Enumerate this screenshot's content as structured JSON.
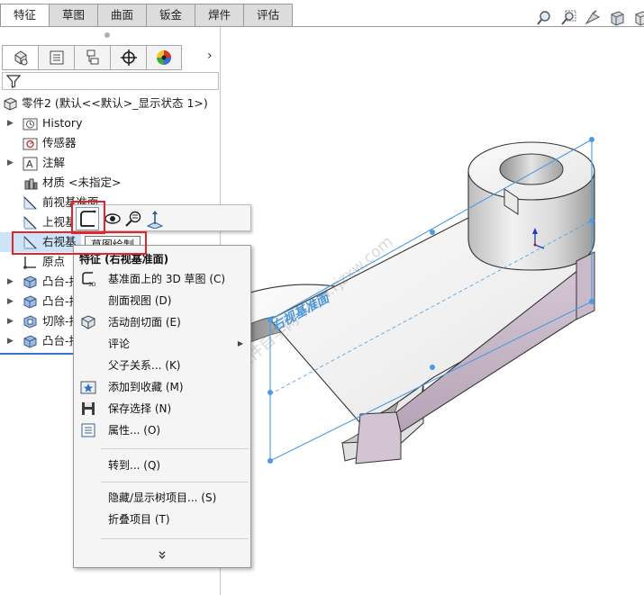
{
  "tabs": [
    "特征",
    "草图",
    "曲面",
    "钣金",
    "焊件",
    "评估"
  ],
  "active_tab": 0,
  "view_tools": [
    "zoom-to-fit-icon",
    "zoom-to-area-icon",
    "previous-view-icon",
    "section-view-icon",
    "view-orientation-icon"
  ],
  "manager_tabs": [
    "feature-manager-icon",
    "property-manager-icon",
    "configuration-manager-icon",
    "dimxpert-manager-icon",
    "display-manager-icon"
  ],
  "manager_more": "›",
  "tree": {
    "root": "零件2  (默认<<默认>_显示状态 1>)",
    "items": [
      {
        "label": "History",
        "icon": "history-folder-icon",
        "expand": true
      },
      {
        "label": "传感器",
        "icon": "sensor-icon",
        "expand": false
      },
      {
        "label": "注解",
        "icon": "annotations-icon",
        "expand": true
      },
      {
        "label": "材质 <未指定>",
        "icon": "material-icon",
        "expand": false
      },
      {
        "label": "前视基准面",
        "icon": "plane-icon",
        "expand": false
      },
      {
        "label": "上视基",
        "icon": "plane-icon",
        "expand": false
      },
      {
        "label": "右视基",
        "icon": "plane-icon",
        "expand": false
      },
      {
        "label": "原点",
        "icon": "origin-icon",
        "expand": false
      },
      {
        "label": "凸台-拉",
        "icon": "boss-extrude-icon",
        "expand": true
      },
      {
        "label": "凸台-拉",
        "icon": "boss-extrude-icon",
        "expand": true
      },
      {
        "label": "切除-拉",
        "icon": "cut-extrude-icon",
        "expand": true
      },
      {
        "label": "凸台-拉",
        "icon": "boss-extrude-icon",
        "expand": true
      }
    ]
  },
  "tooltip": "草图绘制",
  "context_menu": {
    "title": "特征 (右视基准面)",
    "items": [
      {
        "label": "基准面上的 3D 草图 (C)",
        "icon": "3d-sketch-on-plane-icon"
      },
      {
        "label": "剖面视图 (D)",
        "icon": ""
      },
      {
        "label": "活动剖切面 (E)",
        "icon": "live-section-plane-icon"
      },
      {
        "label": "评论",
        "icon": "",
        "submenu": true
      },
      {
        "label": "父子关系... (K)",
        "icon": ""
      },
      {
        "label": "添加到收藏 (M)",
        "icon": "add-to-favorites-icon"
      },
      {
        "label": "保存选择 (N)",
        "icon": "save-selection-icon"
      },
      {
        "label": "属性... (O)",
        "icon": "properties-icon"
      },
      {
        "label": "转到... (Q)",
        "icon": ""
      },
      {
        "label": "隐藏/显示树项目... (S)",
        "icon": ""
      },
      {
        "label": "折叠项目 (T)",
        "icon": ""
      }
    ],
    "more": "»"
  },
  "viewport": {
    "plane_label": "右视基准面",
    "watermark": "软件自学网 www.rjzxw.com"
  },
  "colors": {
    "accent": "#3a86d4",
    "highlight": "#e3242b",
    "plane": "#4a9be3",
    "part_top": "#f0f0f0",
    "part_side": "#c8b8c8"
  }
}
